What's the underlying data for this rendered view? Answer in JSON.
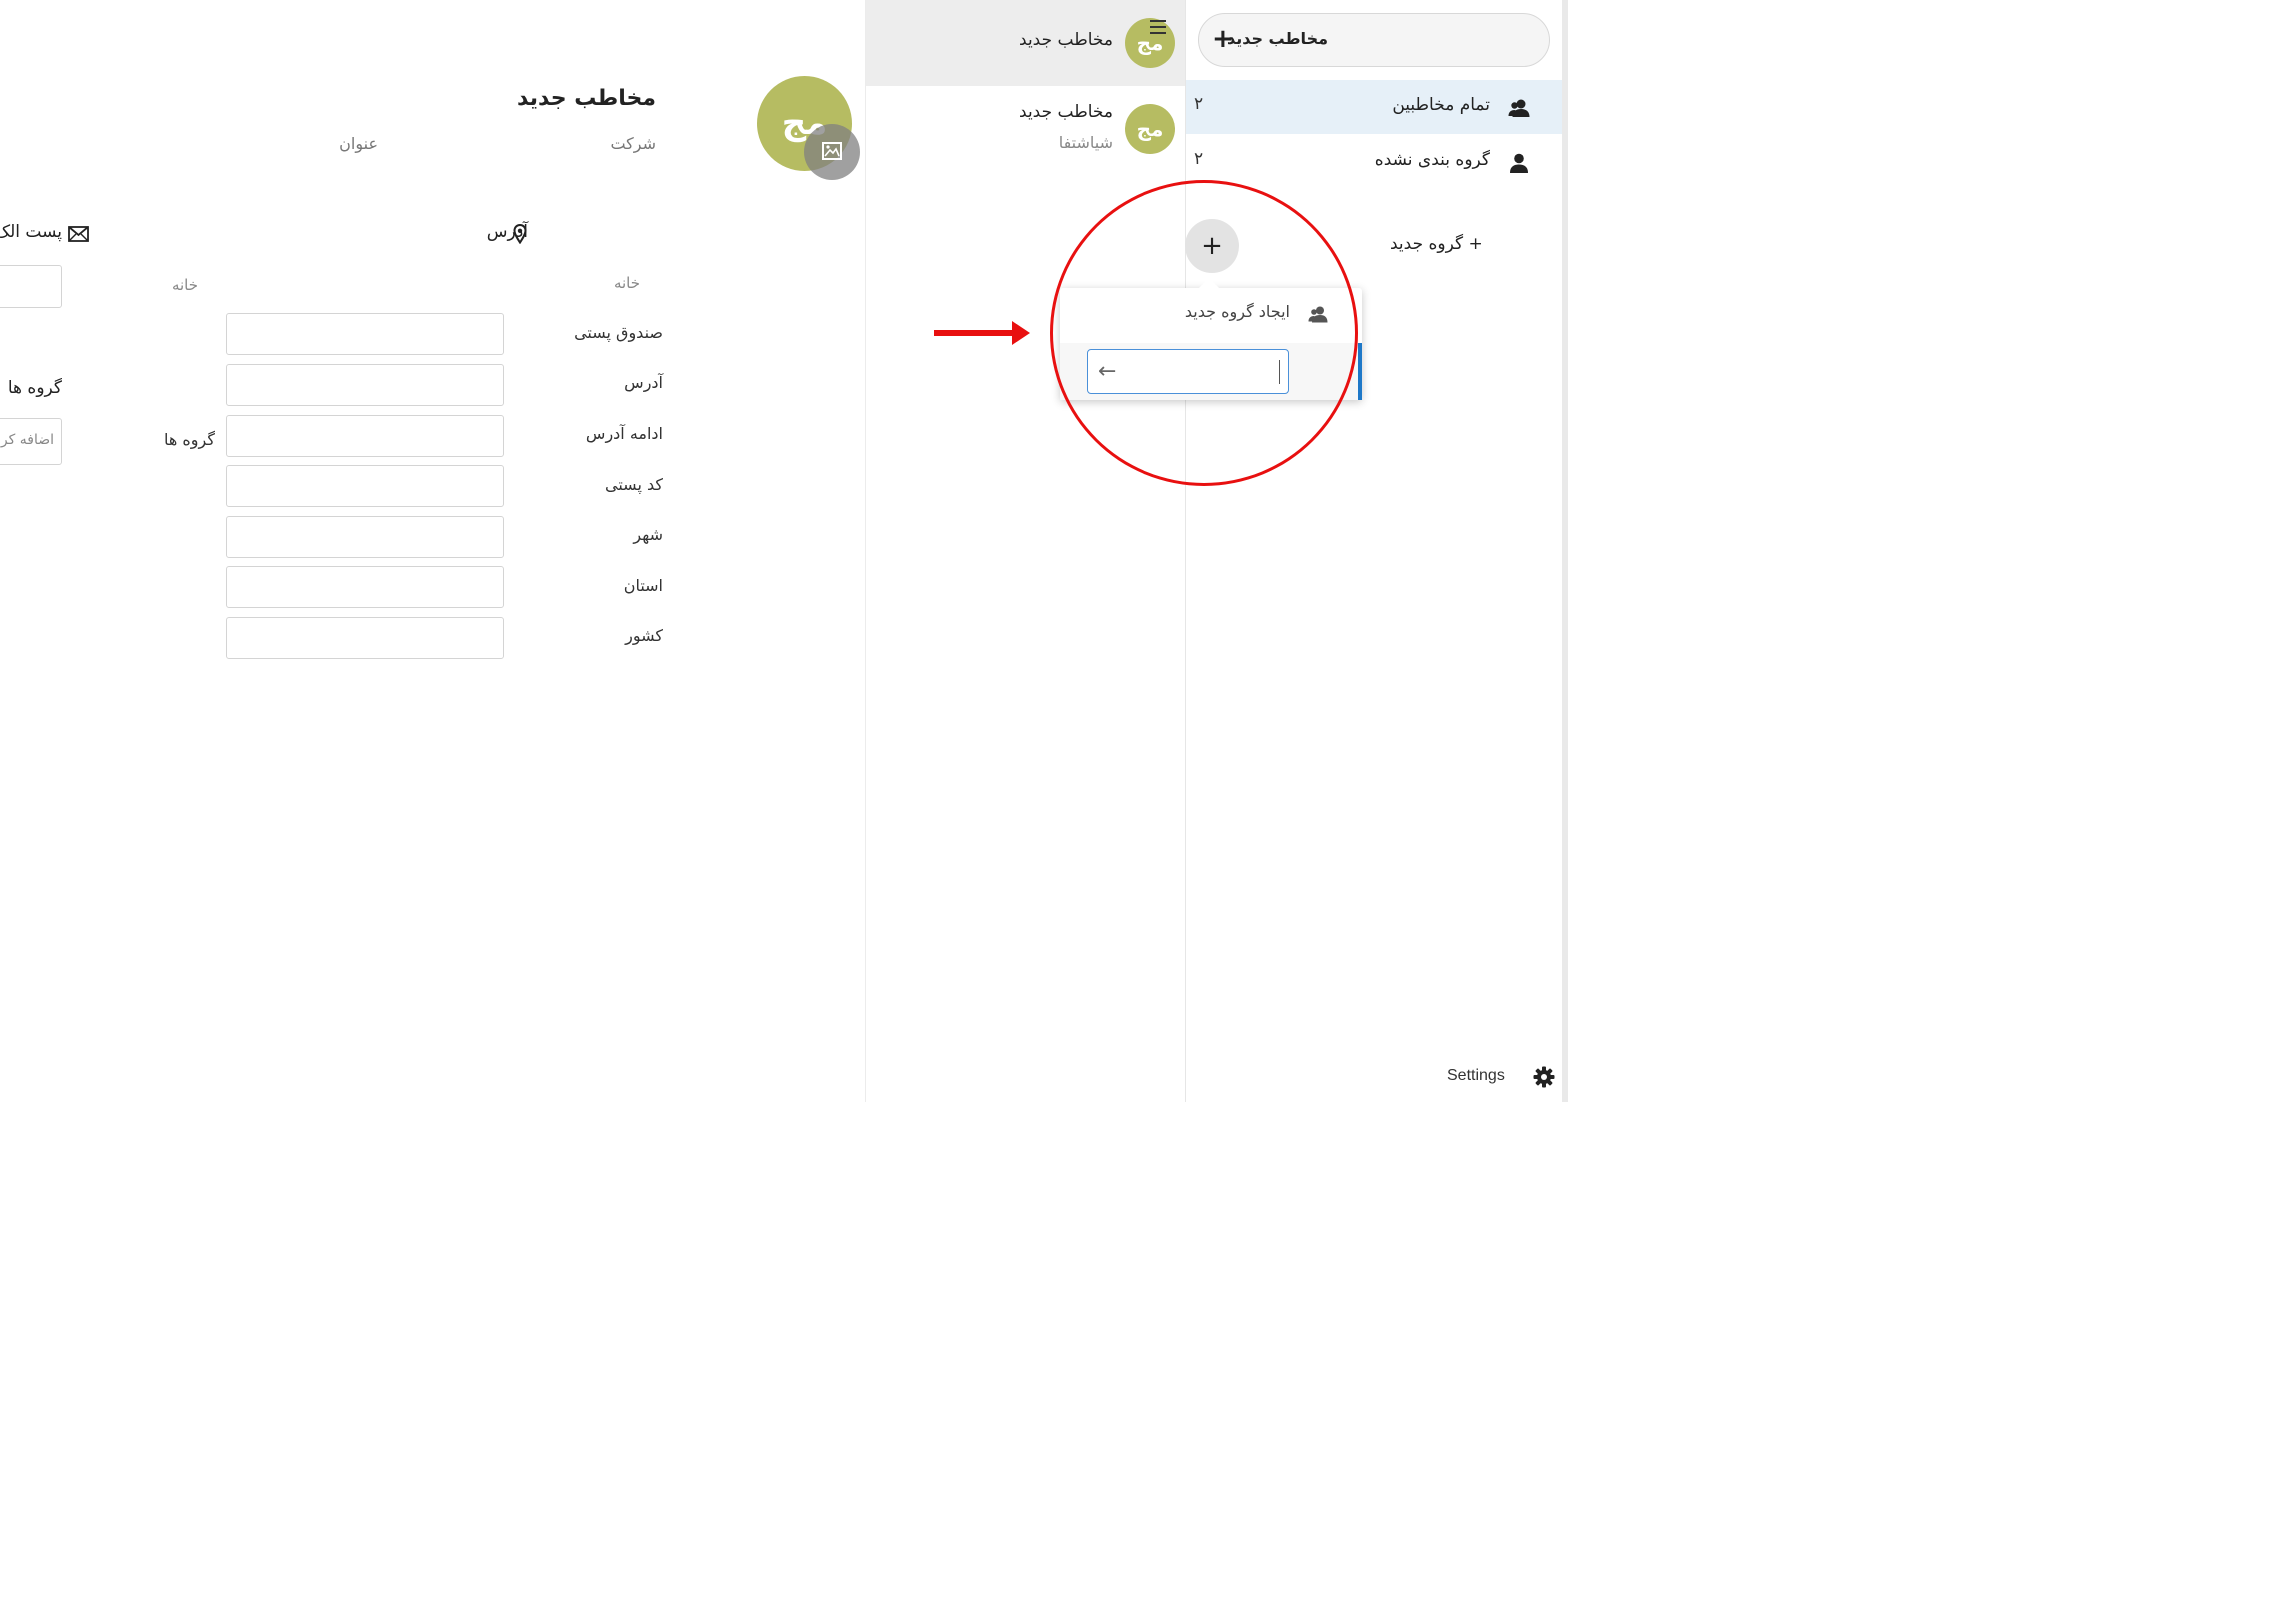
{
  "nav": {
    "new_contact_label": "مخاطب جدید",
    "new_contact_icon": "plus-icon",
    "items": [
      {
        "label": "تمام مخاطبین",
        "count": "۲",
        "icon": "contacts-icon",
        "active": true
      },
      {
        "label": "گروه بندی نشده",
        "count": "۲",
        "icon": "person-icon",
        "active": false
      }
    ],
    "new_group_label": "+ گروه جدید",
    "settings_label": "Settings",
    "settings_icon": "gear-icon"
  },
  "popover": {
    "toggle_symbol": "+",
    "title": "ایجاد گروه جدید",
    "title_icon": "contacts-icon",
    "input_value": "",
    "submit_icon": "arrow-left-icon",
    "submit_symbol": "←"
  },
  "contact_list": {
    "items": [
      {
        "avatar_initials": "مج",
        "name": "مخاطب جدید",
        "subtitle": "",
        "active": true
      },
      {
        "avatar_initials": "مج",
        "name": "مخاطب جدید",
        "subtitle": "شیاشتفا",
        "active": false
      }
    ],
    "menu_icon": "menu-icon"
  },
  "details": {
    "avatar_initials": "مج",
    "photo_icon": "image-icon",
    "name": "مخاطب جدید",
    "company_placeholder": "شرکت",
    "title_placeholder": "عنوان",
    "address": {
      "heading": "آدرس",
      "icon": "map-pin-icon",
      "type": "خانه",
      "fields": [
        {
          "label": "صندوق پستی",
          "value": ""
        },
        {
          "label": "آدرس",
          "value": ""
        },
        {
          "label": "ادامه آدرس",
          "value": ""
        },
        {
          "label": "کد پستی",
          "value": ""
        },
        {
          "label": "شهر",
          "value": ""
        },
        {
          "label": "استان",
          "value": ""
        },
        {
          "label": "کشور",
          "value": ""
        }
      ]
    },
    "email": {
      "heading": "پست الک",
      "icon": "mail-icon",
      "type": "خانه",
      "value": ""
    },
    "groups": {
      "heading": "گروه ها",
      "label": "گروه ها",
      "select_placeholder": "اضافه کر"
    }
  },
  "annotations": {
    "highlight_color": "#e81010",
    "accent_color": "#1e78c8",
    "avatar_color": "#b6bc62"
  }
}
